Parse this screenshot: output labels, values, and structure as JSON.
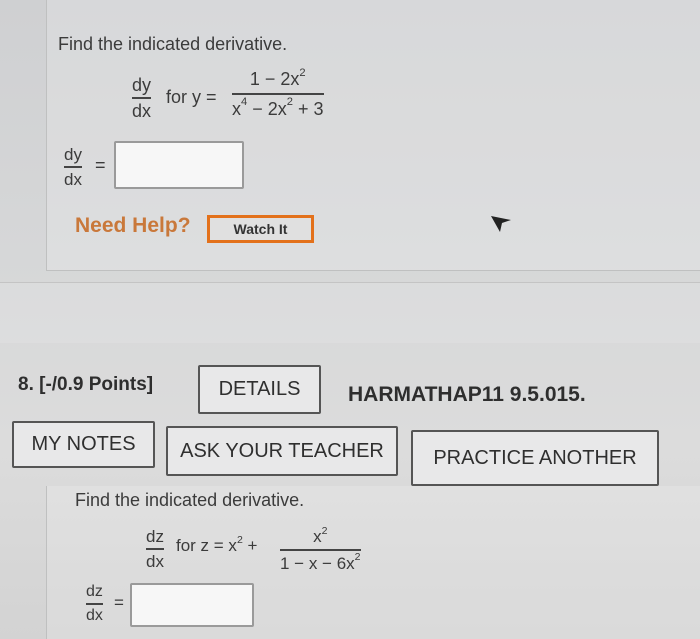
{
  "q7": {
    "prompt": "Find the indicated derivative.",
    "deriv_num": "dy",
    "deriv_den": "dx",
    "for_text": "for y =",
    "expr_num": "1 − 2x",
    "expr_num_exp": "2",
    "expr_den_a": "x",
    "expr_den_a_exp": "4",
    "expr_den_b": " − 2x",
    "expr_den_b_exp": "2",
    "expr_den_c": " + 3",
    "answer_label_num": "dy",
    "answer_label_den": "dx",
    "equals": "=",
    "answer_value": ""
  },
  "help": {
    "need_help": "Need Help?",
    "watch_it": "Watch It"
  },
  "q8": {
    "title": "8. [-/0.9 Points]",
    "details_button": "DETAILS",
    "code": "HARMATHAP11 9.5.015.",
    "my_notes_button": "MY NOTES",
    "ask_teacher_button": "ASK YOUR TEACHER",
    "practice_button": "PRACTICE ANOTHER",
    "prompt": "Find the indicated derivative.",
    "deriv_num": "dz",
    "deriv_den": "dx",
    "for_text": "for z = x",
    "for_exp": "2",
    "plus": " +",
    "expr_num": "x",
    "expr_num_exp": "2",
    "expr_den": "1 − x − 6x",
    "expr_den_exp": "2",
    "answer_label_num": "dz",
    "answer_label_den": "dx",
    "equals": "=",
    "answer_value": ""
  },
  "colors": {
    "accent_orange": "#e3711b",
    "help_text": "#c9783a"
  }
}
